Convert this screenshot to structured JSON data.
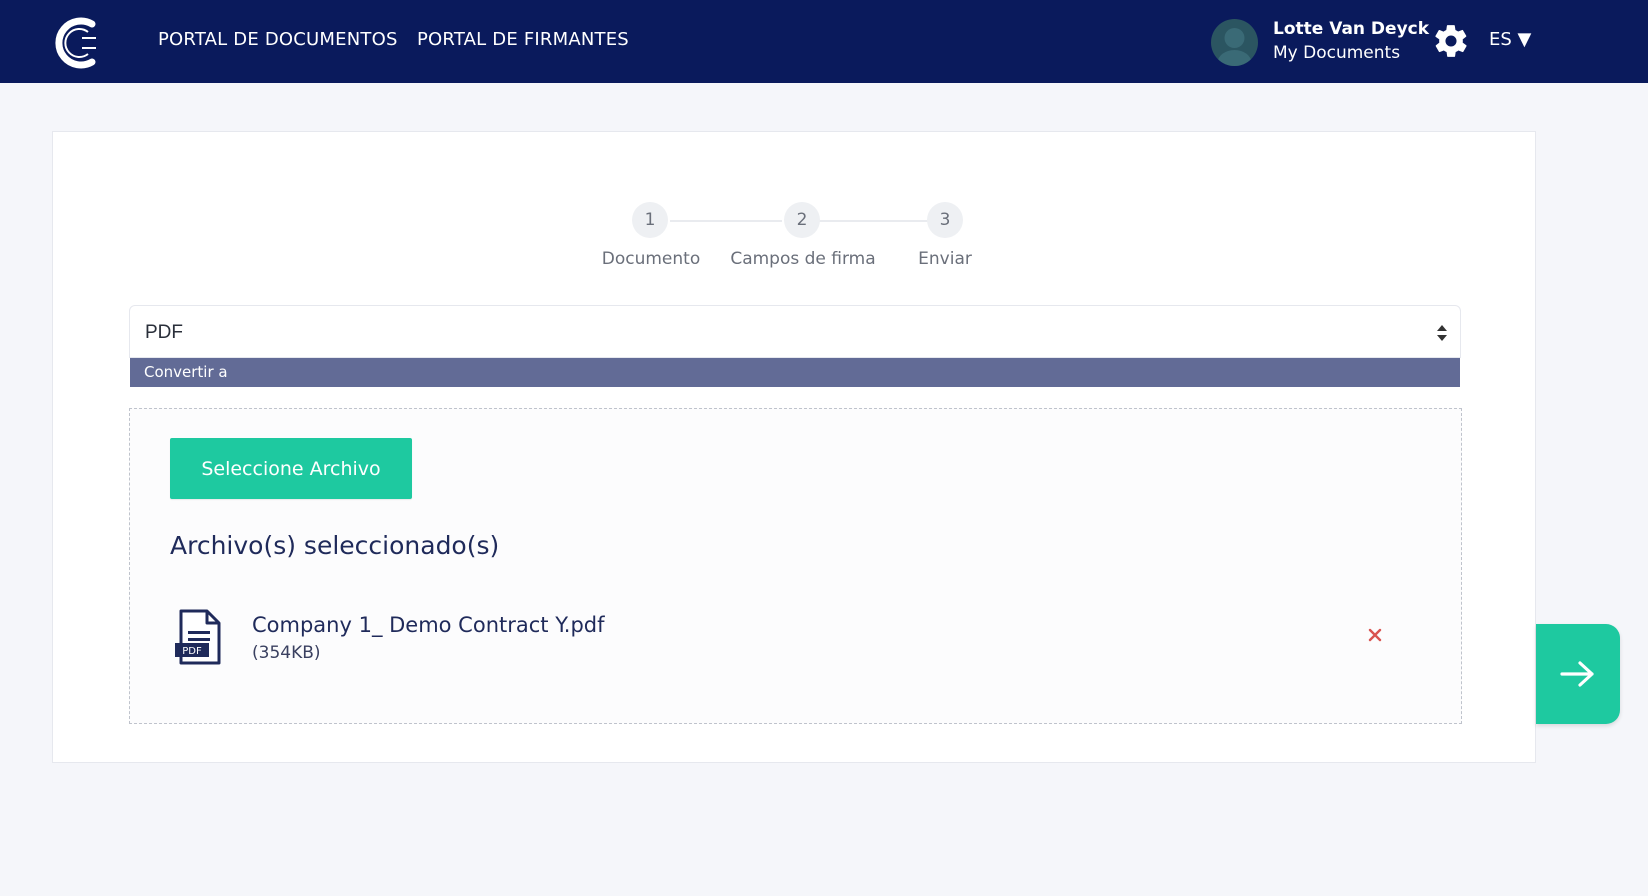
{
  "header": {
    "nav": [
      {
        "label": "PORTAL DE DOCUMENTOS"
      },
      {
        "label": "PORTAL DE FIRMANTES"
      }
    ],
    "user": {
      "name": "Lotte Van Deyck",
      "subtitle": "My Documents"
    },
    "language": "ES ▼",
    "icons": {
      "logo": "company-logo",
      "settings": "gear-icon",
      "avatar": "avatar"
    }
  },
  "stepper": {
    "steps": [
      {
        "number": "1",
        "label": "Documento"
      },
      {
        "number": "2",
        "label": "Campos de firma"
      },
      {
        "number": "3",
        "label": "Enviar"
      }
    ]
  },
  "convert": {
    "selected_value": "PDF",
    "label": "Convertir a"
  },
  "upload": {
    "select_button": "Seleccione Archivo",
    "files_title": "Archivo(s) seleccionado(s)",
    "files": [
      {
        "name": "Company 1_ Demo Contract Y.pdf",
        "size": "(354KB)",
        "icon": "pdf-file-icon",
        "icon_text": "PDF"
      }
    ]
  },
  "colors": {
    "header_bg": "#0a1a5c",
    "accent": "#1ec9a0",
    "convert_bar": "#626b96",
    "remove": "#d9534f"
  }
}
